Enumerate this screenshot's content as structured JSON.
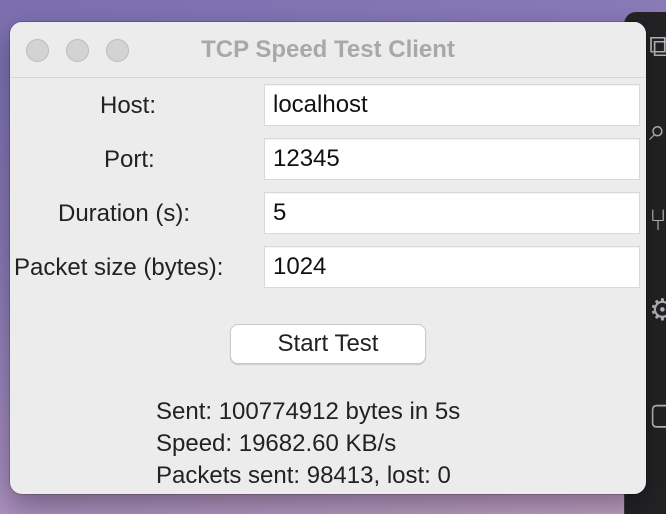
{
  "window": {
    "title": "TCP Speed Test Client"
  },
  "form": {
    "host_label": "Host:",
    "host_value": "localhost",
    "port_label": "Port:",
    "port_value": "12345",
    "duration_label": "Duration (s):",
    "duration_value": "5",
    "packet_size_label": "Packet size (bytes):",
    "packet_size_value": "1024"
  },
  "actions": {
    "start_label": "Start Test"
  },
  "results": {
    "sent": "Sent: 100774912 bytes in 5s",
    "speed": "Speed: 19682.60 KB/s",
    "packets": "Packets sent: 98413, lost: 0"
  },
  "icons": {
    "traffic_close": "close-button-icon",
    "traffic_minimize": "minimize-button-icon",
    "traffic_zoom": "zoom-button-icon"
  },
  "colors": {
    "window_bg": "#ececec",
    "title_text": "#a8a8a8",
    "traffic_inactive": "#d3d3d3"
  }
}
